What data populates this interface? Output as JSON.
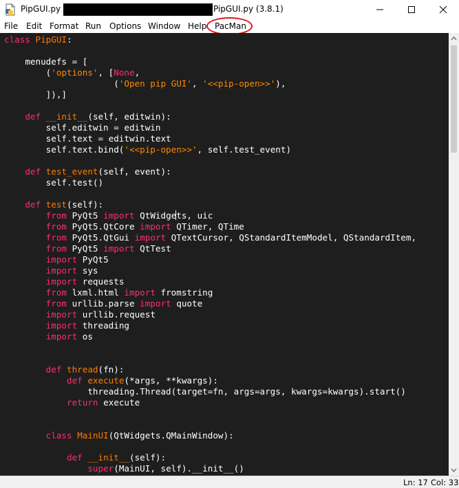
{
  "window": {
    "title_prefix": "PipGUI.py - ",
    "title_suffix": "PipGUI.py (3.8.1)",
    "app_icon": "idle-python-file-icon",
    "controls": [
      "minimize-icon",
      "maximize-icon",
      "close-icon"
    ]
  },
  "menu": {
    "items": [
      "File",
      "Edit",
      "Format",
      "Run",
      "Options",
      "Window",
      "Help",
      "PacMan"
    ],
    "highlight_color": "#e0141e"
  },
  "editor": {
    "background": "#1e1e1e",
    "colors": {
      "keyword": "#ff2d6f",
      "definition": "#ff7a00",
      "string": "#ff8a00",
      "text": "#ffffff"
    },
    "lines": [
      [
        [
          "kw",
          "class"
        ],
        [
          "p",
          " "
        ],
        [
          "def",
          "PipGUI"
        ],
        [
          "p",
          ":"
        ]
      ],
      [],
      [
        [
          "p",
          "    menudefs = ["
        ]
      ],
      [
        [
          "p",
          "        ("
        ],
        [
          "str",
          "'options'"
        ],
        [
          "p",
          ", ["
        ],
        [
          "kw",
          "None"
        ],
        [
          "p",
          ","
        ]
      ],
      [
        [
          "p",
          "                     ("
        ],
        [
          "str",
          "'Open pip GUI'"
        ],
        [
          "p",
          ", "
        ],
        [
          "str",
          "'<<pip-open>>'"
        ],
        [
          "p",
          "),"
        ]
      ],
      [
        [
          "p",
          "        ]),]"
        ]
      ],
      [],
      [
        [
          "p",
          "    "
        ],
        [
          "kw",
          "def"
        ],
        [
          "p",
          " "
        ],
        [
          "def",
          "__init__"
        ],
        [
          "p",
          "(self, editwin):"
        ]
      ],
      [
        [
          "p",
          "        self.editwin = editwin"
        ]
      ],
      [
        [
          "p",
          "        self.text = editwin.text"
        ]
      ],
      [
        [
          "p",
          "        self.text.bind("
        ],
        [
          "str",
          "'<<pip-open>>'"
        ],
        [
          "p",
          ", self.test_event)"
        ]
      ],
      [],
      [
        [
          "p",
          "    "
        ],
        [
          "kw",
          "def"
        ],
        [
          "p",
          " "
        ],
        [
          "def",
          "test_event"
        ],
        [
          "p",
          "(self, event):"
        ]
      ],
      [
        [
          "p",
          "        self.test()"
        ]
      ],
      [],
      [
        [
          "p",
          "    "
        ],
        [
          "kw",
          "def"
        ],
        [
          "p",
          " "
        ],
        [
          "def",
          "test"
        ],
        [
          "p",
          "(self):"
        ]
      ],
      [
        [
          "p",
          "        "
        ],
        [
          "kw",
          "from"
        ],
        [
          "p",
          " PyQt5 "
        ],
        [
          "kw",
          "import"
        ],
        [
          "p",
          " QtWidge"
        ],
        [
          "cursor",
          ""
        ],
        [
          "p",
          "ts, uic"
        ]
      ],
      [
        [
          "p",
          "        "
        ],
        [
          "kw",
          "from"
        ],
        [
          "p",
          " PyQt5.QtCore "
        ],
        [
          "kw",
          "import"
        ],
        [
          "p",
          " QTimer, QTime"
        ]
      ],
      [
        [
          "p",
          "        "
        ],
        [
          "kw",
          "from"
        ],
        [
          "p",
          " PyQt5.QtGui "
        ],
        [
          "kw",
          "import"
        ],
        [
          "p",
          " QTextCursor, QStandardItemModel, QStandardItem,"
        ]
      ],
      [
        [
          "p",
          "        "
        ],
        [
          "kw",
          "from"
        ],
        [
          "p",
          " PyQt5 "
        ],
        [
          "kw",
          "import"
        ],
        [
          "p",
          " QtTest"
        ]
      ],
      [
        [
          "p",
          "        "
        ],
        [
          "kw",
          "import"
        ],
        [
          "p",
          " PyQt5"
        ]
      ],
      [
        [
          "p",
          "        "
        ],
        [
          "kw",
          "import"
        ],
        [
          "p",
          " sys"
        ]
      ],
      [
        [
          "p",
          "        "
        ],
        [
          "kw",
          "import"
        ],
        [
          "p",
          " requests"
        ]
      ],
      [
        [
          "p",
          "        "
        ],
        [
          "kw",
          "from"
        ],
        [
          "p",
          " lxml.html "
        ],
        [
          "kw",
          "import"
        ],
        [
          "p",
          " fromstring"
        ]
      ],
      [
        [
          "p",
          "        "
        ],
        [
          "kw",
          "from"
        ],
        [
          "p",
          " urllib.parse "
        ],
        [
          "kw",
          "import"
        ],
        [
          "p",
          " quote"
        ]
      ],
      [
        [
          "p",
          "        "
        ],
        [
          "kw",
          "import"
        ],
        [
          "p",
          " urllib.request"
        ]
      ],
      [
        [
          "p",
          "        "
        ],
        [
          "kw",
          "import"
        ],
        [
          "p",
          " threading"
        ]
      ],
      [
        [
          "p",
          "        "
        ],
        [
          "kw",
          "import"
        ],
        [
          "p",
          " os"
        ]
      ],
      [],
      [],
      [
        [
          "p",
          "        "
        ],
        [
          "kw",
          "def"
        ],
        [
          "p",
          " "
        ],
        [
          "def",
          "thread"
        ],
        [
          "p",
          "(fn):"
        ]
      ],
      [
        [
          "p",
          "            "
        ],
        [
          "kw",
          "def"
        ],
        [
          "p",
          " "
        ],
        [
          "def",
          "execute"
        ],
        [
          "p",
          "(*args, **kwargs):"
        ]
      ],
      [
        [
          "p",
          "                threading.Thread(target=fn, args=args, kwargs=kwargs).start()"
        ]
      ],
      [
        [
          "p",
          "            "
        ],
        [
          "kw",
          "return"
        ],
        [
          "p",
          " execute"
        ]
      ],
      [],
      [],
      [
        [
          "p",
          "        "
        ],
        [
          "kw",
          "class"
        ],
        [
          "p",
          " "
        ],
        [
          "def",
          "MainUI"
        ],
        [
          "p",
          "(QtWidgets.QMainWindow):"
        ]
      ],
      [],
      [
        [
          "p",
          "            "
        ],
        [
          "kw",
          "def"
        ],
        [
          "p",
          " "
        ],
        [
          "def",
          "__init__"
        ],
        [
          "p",
          "(self):"
        ]
      ],
      [
        [
          "p",
          "                "
        ],
        [
          "kw",
          "super"
        ],
        [
          "p",
          "(MainUI, self).__init__()"
        ]
      ]
    ]
  },
  "status": {
    "line": "Ln: 17",
    "col": "Col: 33"
  }
}
